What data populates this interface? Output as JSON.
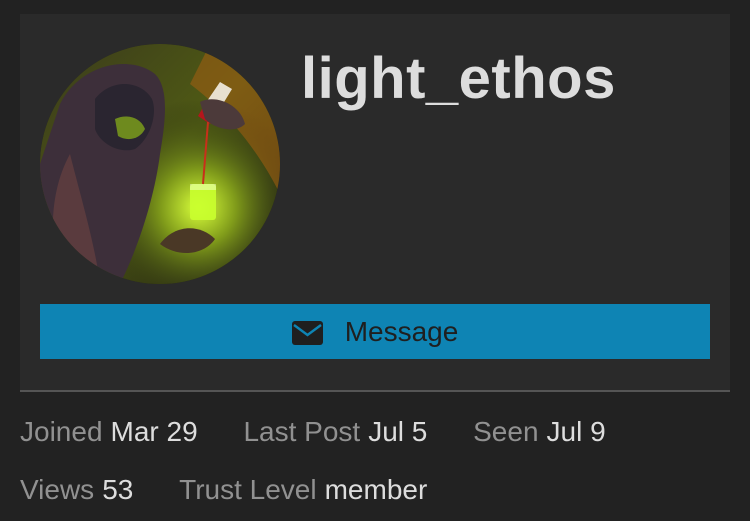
{
  "user": {
    "username": "light_ethos",
    "avatar_icon": "wizard-avatar-icon"
  },
  "actions": {
    "message_label": "Message",
    "message_icon": "envelope-icon",
    "button_color": "#0e84b4"
  },
  "stats": {
    "joined": {
      "label": "Joined",
      "value": "Mar 29"
    },
    "last_post": {
      "label": "Last Post",
      "value": "Jul 5"
    },
    "seen": {
      "label": "Seen",
      "value": "Jul 9"
    },
    "views": {
      "label": "Views",
      "value": "53"
    },
    "trust_level": {
      "label": "Trust Level",
      "value": "member"
    }
  }
}
